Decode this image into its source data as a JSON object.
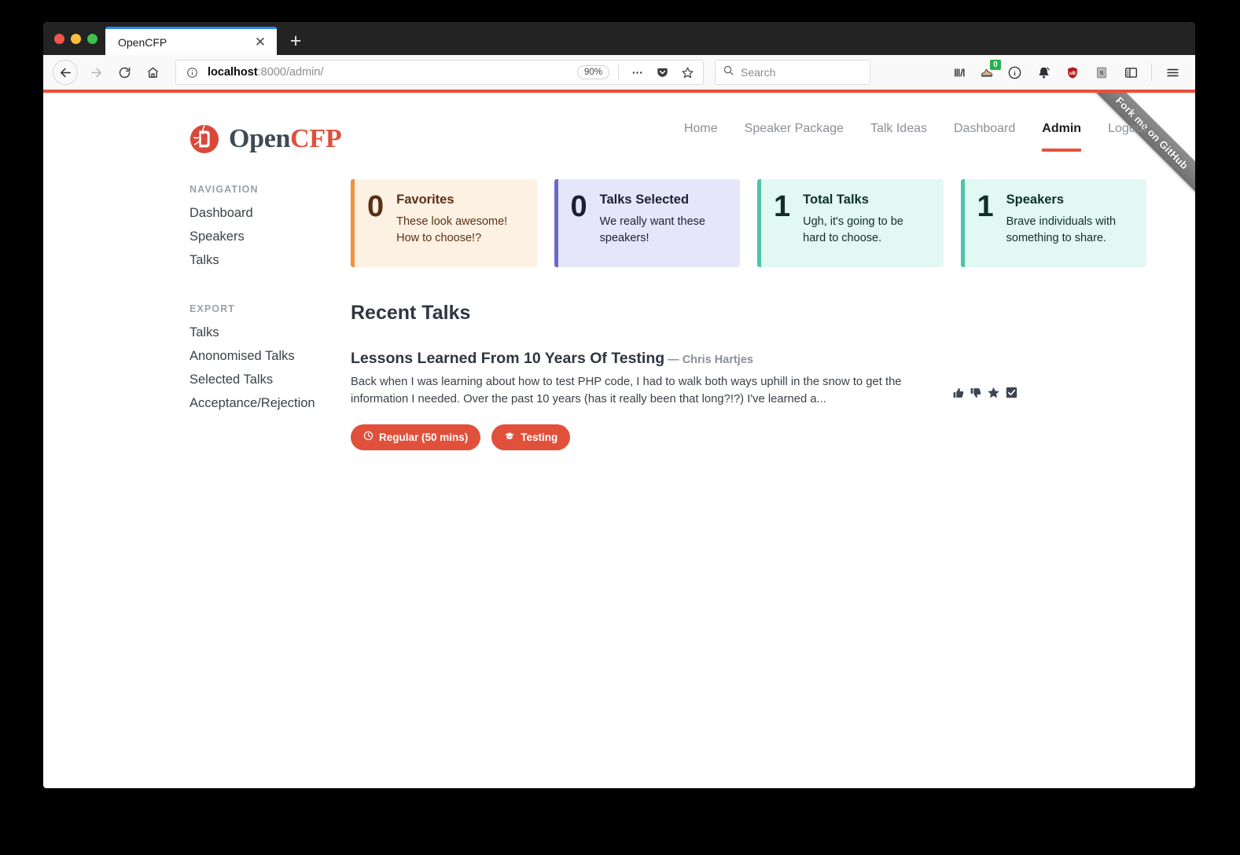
{
  "browser": {
    "tab": {
      "title": "OpenCFP",
      "close_icon": "close-icon"
    },
    "new_tab_label": "+",
    "nav": {
      "back_icon": "back-arrow-icon",
      "forward_icon": "forward-arrow-icon",
      "reload_icon": "reload-icon",
      "home_icon": "home-icon"
    },
    "url": {
      "info_icon": "info-circle-icon",
      "host": "localhost",
      "path": ":8000/admin/",
      "zoom_level": "90%",
      "page_actions_icon": "ellipsis-icon",
      "pocket_icon": "pocket-icon",
      "bookmark_icon": "star-outline-icon"
    },
    "search": {
      "placeholder": "Search",
      "icon": "search-icon"
    },
    "toolbar_icons": [
      {
        "name": "library-icon"
      },
      {
        "name": "extension-shoe-icon",
        "badge": "0",
        "badge_color": "#24b14b"
      },
      {
        "name": "info-circle-icon"
      },
      {
        "name": "notification-bell-icon"
      },
      {
        "name": "ublock-shield-icon"
      },
      {
        "name": "stylish-s-icon"
      },
      {
        "name": "sidebar-toggle-icon"
      },
      {
        "name": "hamburger-menu-icon"
      }
    ]
  },
  "page": {
    "ribbon": "Fork me on GitHub",
    "brand": {
      "open": "Open",
      "cfp": "CFP",
      "mark_icon": "opencfp-logo-icon"
    },
    "nav": [
      {
        "label": "Home",
        "active": false
      },
      {
        "label": "Speaker Package",
        "active": false
      },
      {
        "label": "Talk Ideas",
        "active": false
      },
      {
        "label": "Dashboard",
        "active": false
      },
      {
        "label": "Admin",
        "active": true
      },
      {
        "label": "Logout",
        "active": false
      }
    ],
    "sidebar": {
      "navigation_heading": "NAVIGATION",
      "navigation_items": [
        {
          "label": "Dashboard"
        },
        {
          "label": "Speakers"
        },
        {
          "label": "Talks"
        }
      ],
      "export_heading": "EXPORT",
      "export_items": [
        {
          "label": "Talks"
        },
        {
          "label": "Anonomised Talks"
        },
        {
          "label": "Selected Talks"
        },
        {
          "label": "Acceptance/Rejection"
        }
      ]
    },
    "cards": [
      {
        "value": "0",
        "title": "Favorites",
        "desc": "These look awesome! How to choose!?",
        "accent": "#f0923f",
        "bg": "#fdf1e3"
      },
      {
        "value": "0",
        "title": "Talks Selected",
        "desc": "We really want these speakers!",
        "accent": "#6a6ac9",
        "bg": "#e6e6fa"
      },
      {
        "value": "1",
        "title": "Total Talks",
        "desc": "Ugh, it's going to be hard to choose.",
        "accent": "#4ec3ac",
        "bg": "#e2f8f2"
      },
      {
        "value": "1",
        "title": "Speakers",
        "desc": "Brave individuals with something to share.",
        "accent": "#4ec3ac",
        "bg": "#e2f8f2"
      }
    ],
    "section_title": "Recent Talks",
    "talk": {
      "title": "Lessons Learned From 10 Years Of Testing",
      "author": "— Chris Hartjes",
      "description": "Back when I was learning about how to test PHP code, I had to walk both ways uphill in the snow to get the information I needed. Over the past 10 years (has it really been that long?!?) I've learned a...",
      "tags": [
        {
          "label": "Regular (50 mins)",
          "icon": "clock-icon"
        },
        {
          "label": "Testing",
          "icon": "graduation-cap-icon"
        }
      ],
      "actions": [
        {
          "name": "thumbs-up-icon"
        },
        {
          "name": "thumbs-down-icon"
        },
        {
          "name": "star-icon"
        },
        {
          "name": "checkbox-checked-icon"
        }
      ]
    }
  }
}
